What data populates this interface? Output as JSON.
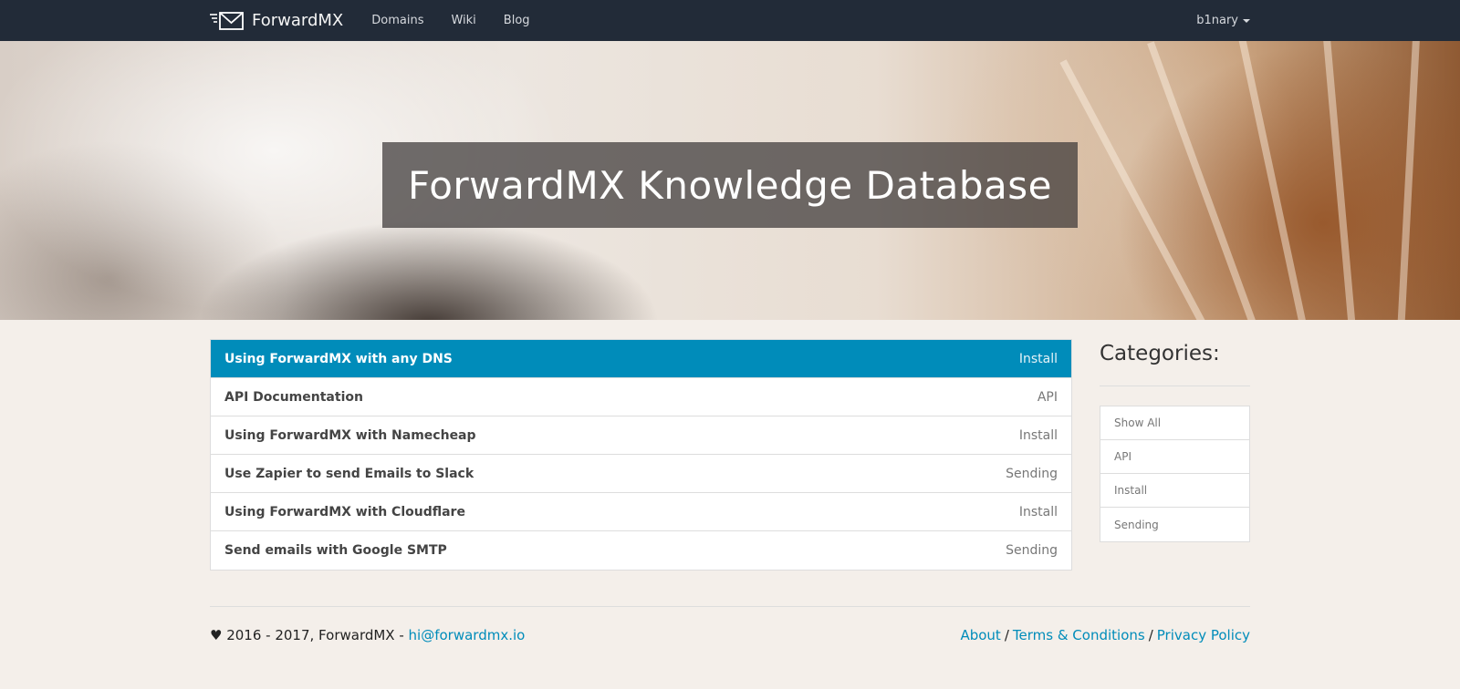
{
  "navbar": {
    "brand": "ForwardMX",
    "links": [
      "Domains",
      "Wiki",
      "Blog"
    ],
    "user": "b1nary"
  },
  "hero": {
    "title": "ForwardMX Knowledge Database"
  },
  "articles": [
    {
      "title": "Using ForwardMX with any DNS",
      "category": "Install",
      "active": true
    },
    {
      "title": "API Documentation",
      "category": "API",
      "active": false
    },
    {
      "title": "Using ForwardMX with Namecheap",
      "category": "Install",
      "active": false
    },
    {
      "title": "Use Zapier to send Emails to Slack",
      "category": "Sending",
      "active": false
    },
    {
      "title": "Using ForwardMX with Cloudflare",
      "category": "Install",
      "active": false
    },
    {
      "title": "Send emails with Google SMTP",
      "category": "Sending",
      "active": false
    }
  ],
  "sidebar": {
    "title": "Categories:",
    "items": [
      "Show All",
      "API",
      "Install",
      "Sending"
    ]
  },
  "footer": {
    "copyright": "♥ 2016 - 2017, ForwardMX - ",
    "email": "hi@forwardmx.io",
    "links": [
      "About",
      "Terms & Conditions",
      "Privacy Policy"
    ],
    "separator": "/"
  },
  "colors": {
    "navbar_bg": "#222b38",
    "accent": "#008cba",
    "page_bg": "#f4efea"
  }
}
